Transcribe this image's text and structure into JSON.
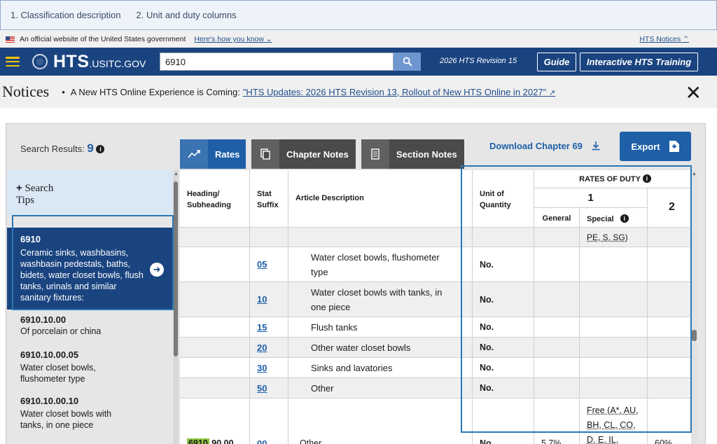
{
  "annotation_tabs": [
    "1. Classification description",
    "2. Unit and duty columns"
  ],
  "gov_banner": {
    "text": "An official website of the United States government",
    "link": "Here's how you know",
    "notices_link": "HTS Notices"
  },
  "header": {
    "logo_main": "HTS",
    "logo_sub": ".USITC.GOV",
    "search_value": "6910",
    "revision": "2026 HTS Revision 15",
    "guide_label": "Guide",
    "training_label": "Interactive HTS Training"
  },
  "notices": {
    "title": "Notices",
    "bullet": "•",
    "message": "A New HTS Online Experience is Coming:",
    "link_text": "\"HTS Updates: 2026 HTS Revision 13, Rollout of New HTS Online in 2027\""
  },
  "toolbar": {
    "results_label": "Search Results:",
    "results_count": "9",
    "tab_rates": "Rates",
    "tab_chapter_notes": "Chapter Notes",
    "tab_section_notes": "Section Notes",
    "download": "Download Chapter 69",
    "export": "Export"
  },
  "sidebar": {
    "tips_plus": "+",
    "tips_line1": "Search",
    "tips_line2": "Tips",
    "items": [
      {
        "code": "6910",
        "desc": "Ceramic sinks, washbasins, washbasin pedestals, baths, bidets, water closet bowls, flush tanks, urinals and similar sanitary fixtures:"
      },
      {
        "code": "6910.10.00",
        "desc": "Of porcelain or china"
      },
      {
        "code": "6910.10.00.05",
        "desc": "Water closet bowls, flushometer type"
      },
      {
        "code": "6910.10.00.10",
        "desc": "Water closet bowls with tanks, in one piece"
      }
    ]
  },
  "table": {
    "headers": {
      "heading": "Heading/\nSubheading",
      "stat": "Stat\nSuffix",
      "article": "Article Description",
      "unit": "Unit of\nQuantity",
      "rates": "RATES OF DUTY",
      "col1": "1",
      "general": "General",
      "special": "Special",
      "col2": "2"
    },
    "partial_special": "PE, S, SG)",
    "rows": [
      {
        "stat": "05",
        "desc": "Water closet bowls, flushometer type",
        "unit": "No."
      },
      {
        "stat": "10",
        "desc": "Water closet bowls with tanks, in one piece",
        "unit": "No."
      },
      {
        "stat": "15",
        "desc": "Flush tanks",
        "unit": "No."
      },
      {
        "stat": "20",
        "desc": "Other water closet bowls",
        "unit": "No."
      },
      {
        "stat": "30",
        "desc": "Sinks and lavatories",
        "unit": "No."
      },
      {
        "stat": "50",
        "desc": "Other",
        "unit": "No."
      }
    ],
    "last_row": {
      "heading_hl": "6910",
      "heading_rest": ".90.00",
      "stat": "00",
      "desc": "Other",
      "unit": "No.",
      "general": "5.7%",
      "special": "Free (A*, AU, BH, CL, CO, D, E, IL,",
      "col2": "60%"
    }
  }
}
